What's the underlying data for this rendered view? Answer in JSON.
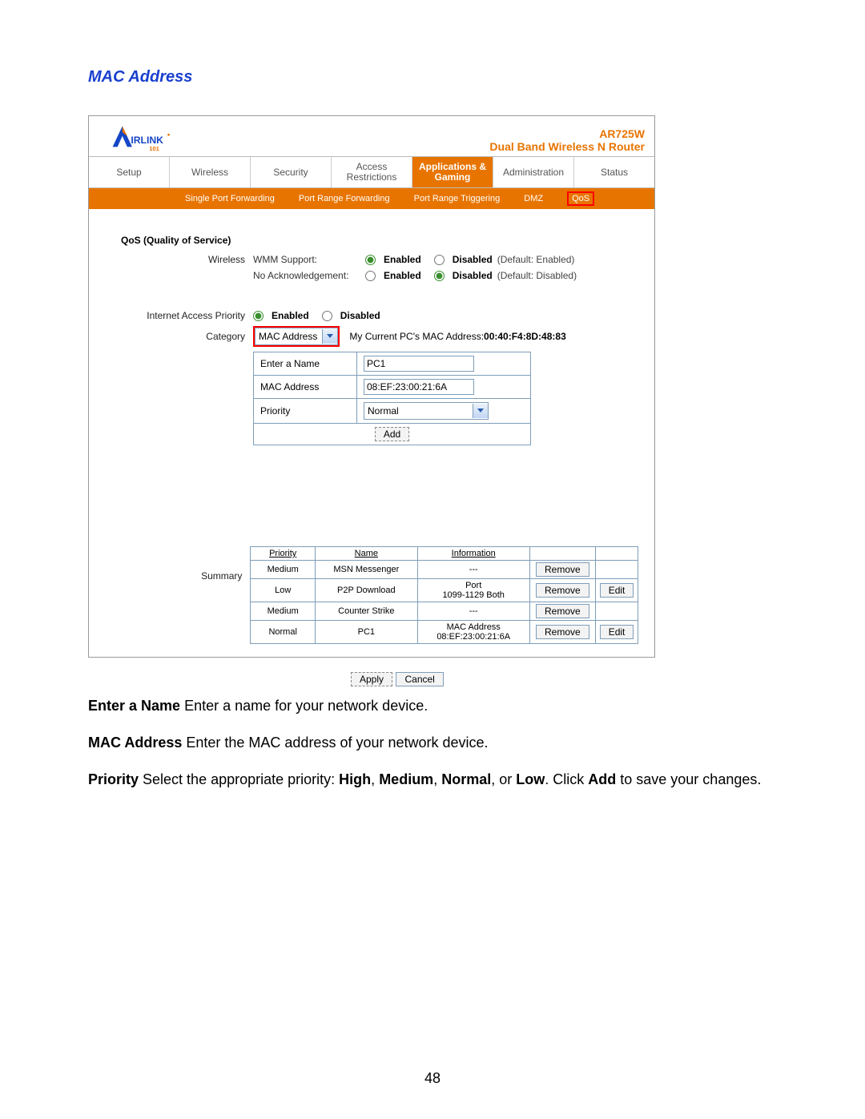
{
  "title": "MAC Address",
  "header": {
    "model": "AR725W",
    "product_line": "Dual Band Wireless N Router",
    "logo_text_main": "IRLINK",
    "logo_text_sub": "101"
  },
  "main_tabs": [
    {
      "label": "Setup",
      "active": false
    },
    {
      "label": "Wireless",
      "active": false
    },
    {
      "label": "Security",
      "active": false
    },
    {
      "label": "Access\nRestrictions",
      "active": false
    },
    {
      "label": "Applications &\nGaming",
      "active": true
    },
    {
      "label": "Administration",
      "active": false
    },
    {
      "label": "Status",
      "active": false
    }
  ],
  "sub_tabs": [
    "Single Port Forwarding",
    "Port Range Forwarding",
    "Port Range Triggering",
    "DMZ",
    "QoS"
  ],
  "qos": {
    "section_label": "QoS (Quality of Service)",
    "wireless_label": "Wireless",
    "wmm_label": "WMM Support:",
    "noack_label": "No Acknowledgement:",
    "enabled": "Enabled",
    "disabled": "Disabled",
    "wmm_default": "(Default: Enabled)",
    "noack_default": "(Default: Disabled)",
    "iap_label": "Internet Access Priority",
    "category_label": "Category",
    "category_value": "MAC Address",
    "mac_note_prefix": "My Current PC's MAC Address:",
    "mac_note_value": "00:40:F4:8D:48:83",
    "form": {
      "name_label": "Enter a Name",
      "name_value": "PC1",
      "mac_label": "MAC Address",
      "mac_value": "08:EF:23:00:21:6A",
      "priority_label": "Priority",
      "priority_value": "Normal",
      "add_label": "Add"
    },
    "summary_label": "Summary",
    "summary_headers": [
      "Priority",
      "Name",
      "Information",
      "",
      ""
    ],
    "summary_rows": [
      {
        "priority": "Medium",
        "name": "MSN Messenger",
        "info": "---",
        "remove": "Remove",
        "edit": ""
      },
      {
        "priority": "Low",
        "name": "P2P Download",
        "info": "Port\n1099-1129  Both",
        "remove": "Remove",
        "edit": "Edit"
      },
      {
        "priority": "Medium",
        "name": "Counter Strike",
        "info": "---",
        "remove": "Remove",
        "edit": ""
      },
      {
        "priority": "Normal",
        "name": "PC1",
        "info": "MAC Address\n08:EF:23:00:21:6A",
        "remove": "Remove",
        "edit": "Edit"
      }
    ]
  },
  "buttons": {
    "apply": "Apply",
    "cancel": "Cancel"
  },
  "descriptions": {
    "name": {
      "b": "Enter a Name",
      "t": " Enter a name for your network device."
    },
    "mac": {
      "b": "MAC Address",
      "t": " Enter the MAC address of your network device."
    },
    "priority": {
      "b": "Priority",
      "t1": " Select the appropriate priority: ",
      "h": "High",
      "m": "Medium",
      "n": "Normal",
      "l": "Low",
      "t2": ". Click ",
      "add": "Add",
      "t3": " to save your changes."
    }
  },
  "page_number": "48"
}
